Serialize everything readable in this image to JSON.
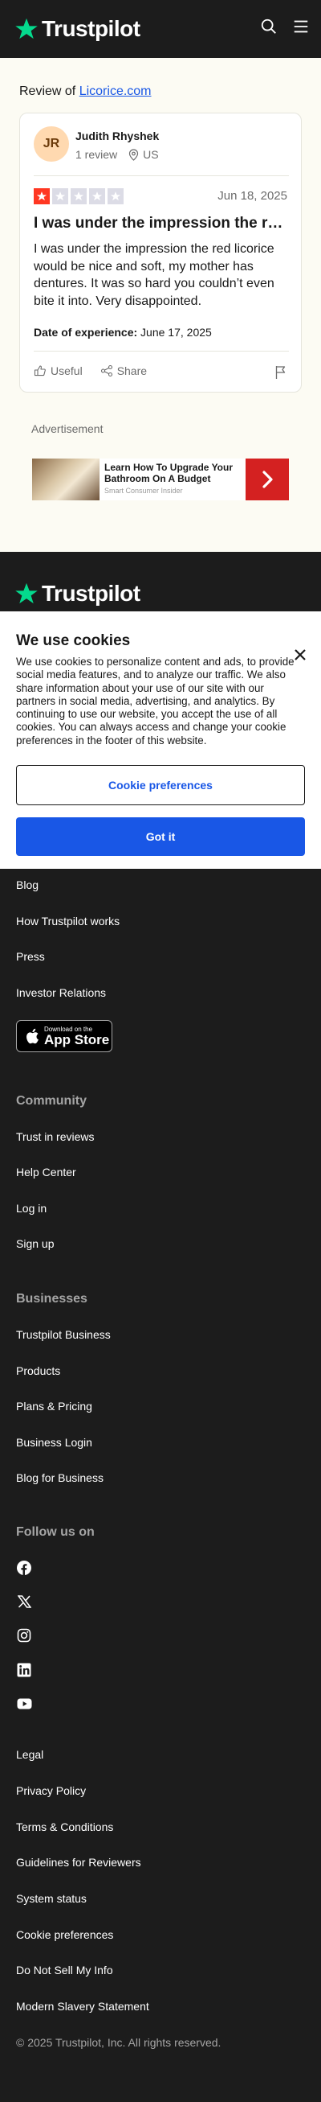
{
  "header": {
    "logo_text": "Trustpilot",
    "icons": [
      "search-icon",
      "menu-icon"
    ]
  },
  "review_of": {
    "prefix": "Review of ",
    "company": "Licorice.com"
  },
  "review": {
    "avatar_initials": "JR",
    "reviewer_name": "Judith Rhyshek",
    "review_count": "1 review",
    "country": "US",
    "rating": 1,
    "max_rating": 5,
    "date": "Jun 18, 2025",
    "title": "I was under the impression the red licorice would be nice and soft, my mother has dentures.",
    "body": "I was under the impression the red licorice would be nice and soft, my mother has dentures. It was so hard you couldn’t even bite it into. Very disappointed.",
    "experience_label": "Date of experience:",
    "experience_date": " June 17, 2025",
    "useful_label": "Useful",
    "share_label": "Share"
  },
  "advertisement": {
    "label": "Advertisement",
    "title": "Learn How To Upgrade Your Bathroom On A Budget",
    "source": "Smart Consumer Insider"
  },
  "cookie_banner": {
    "title": "We use cookies",
    "text": "We use cookies to personalize content and ads, to provide social media features, and to analyze our traffic. We also share information about your use of our site with our partners in social media, advertising, and analytics. By continuing to use our website, you accept the use of all cookies. You can always access and change your cookie preferences in the footer of this website.",
    "preferences_label": "Cookie preferences",
    "accept_label": "Got it"
  },
  "footer": {
    "logo_text": "Trustpilot",
    "about_links": [
      "Blog",
      "How Trustpilot works",
      "Press",
      "Investor Relations"
    ],
    "app_store": {
      "small": "Download on the",
      "big": "App Store"
    },
    "community_heading": "Community",
    "community_links": [
      "Trust in reviews",
      "Help Center",
      "Log in",
      "Sign up"
    ],
    "businesses_heading": "Businesses",
    "businesses_links": [
      "Trustpilot Business",
      "Products",
      "Plans & Pricing",
      "Business Login",
      "Blog for Business"
    ],
    "follow_heading": "Follow us on",
    "social_icons": [
      "facebook-icon",
      "x-icon",
      "instagram-icon",
      "linkedin-icon",
      "youtube-icon"
    ],
    "legal_links": [
      "Legal",
      "Privacy Policy",
      "Terms & Conditions",
      "Guidelines for Reviewers",
      "System status",
      "Cookie preferences",
      "Do Not Sell My Info",
      "Modern Slavery Statement"
    ],
    "copyright": "© 2025 Trustpilot, Inc. All rights reserved."
  },
  "colors": {
    "brand_green": "#04da8d",
    "one_star_red": "#ff3722",
    "link_blue": "#1957e6",
    "dark_bg": "#1c1c1c",
    "page_bg": "#fcfbf3"
  }
}
